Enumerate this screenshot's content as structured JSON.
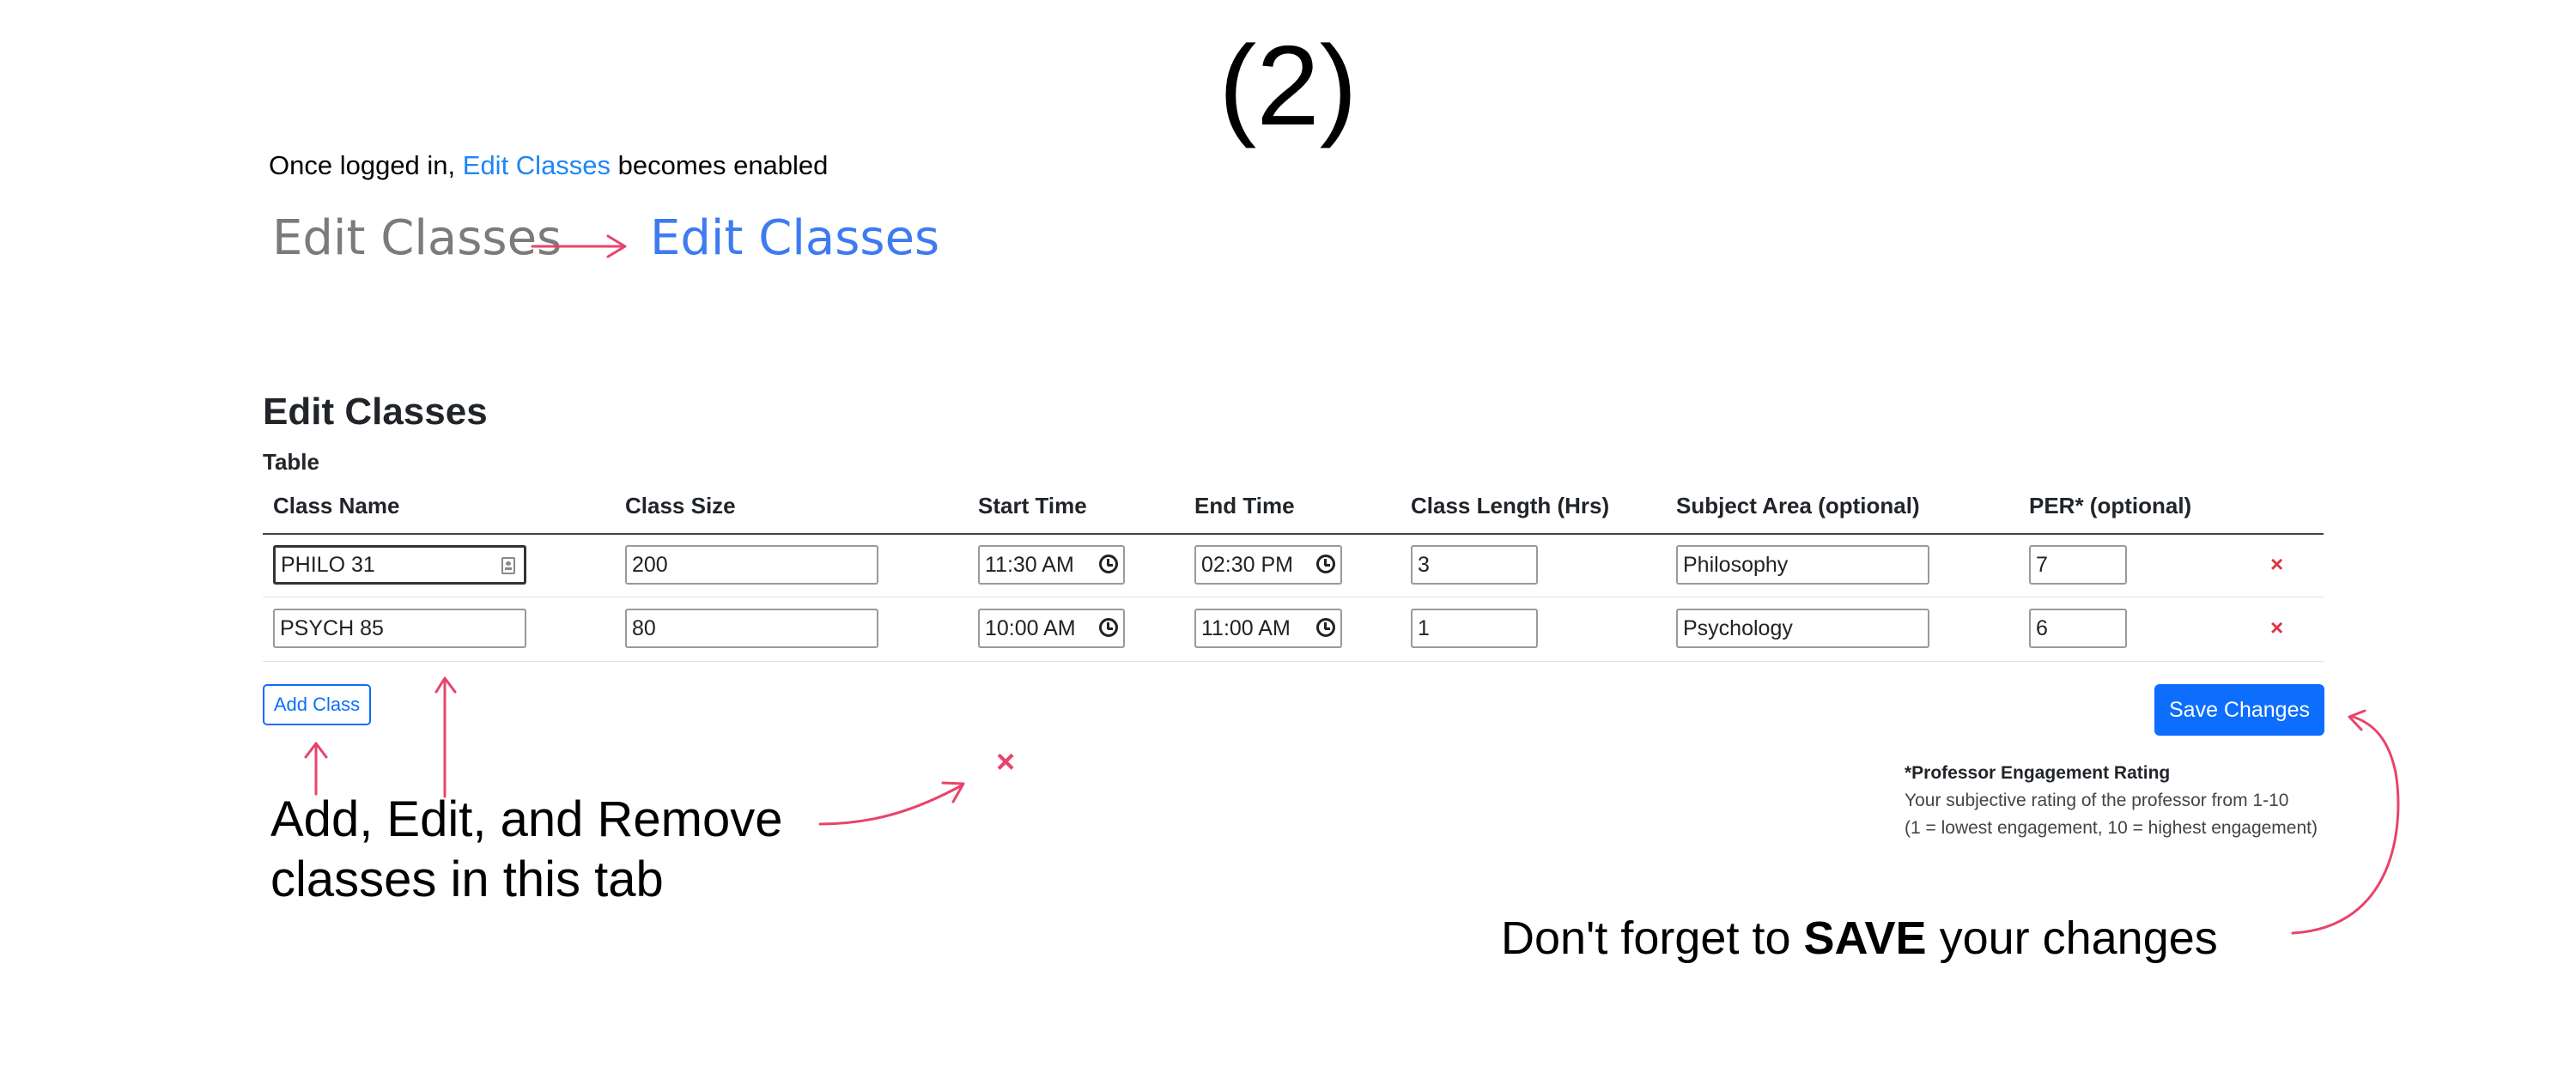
{
  "header": {
    "step": "(2)"
  },
  "intro": {
    "prefix": "Once logged in, ",
    "link": "Edit Classes",
    "suffix": " becomes enabled"
  },
  "nav_demo": {
    "disabled_label": "Edit Classes",
    "enabled_label": "Edit Classes"
  },
  "section": {
    "title": "Edit Classes",
    "table_caption": "Table"
  },
  "table": {
    "headers": [
      "Class Name",
      "Class Size",
      "Start Time",
      "End Time",
      "Class Length (Hrs)",
      "Subject Area (optional)",
      "PER* (optional)"
    ],
    "rows": [
      {
        "class_name": "PHILO 31",
        "class_size": "200",
        "start_time": "11:30 AM",
        "end_time": "02:30 PM",
        "length": "3",
        "subject": "Philosophy",
        "per": "7",
        "remove": "×"
      },
      {
        "class_name": "PSYCH 85",
        "class_size": "80",
        "start_time": "10:00 AM",
        "end_time": "11:00 AM",
        "length": "1",
        "subject": "Psychology",
        "per": "6",
        "remove": "×"
      }
    ]
  },
  "buttons": {
    "add_class": "Add Class",
    "save_changes": "Save Changes"
  },
  "per_note": {
    "title": "*Professor Engagement Rating",
    "line1": "Your subjective rating of the professor from 1-10",
    "line2": "(1 = lowest engagement, 10 = highest engagement)"
  },
  "annotations": {
    "left_line1": "Add, Edit, and Remove",
    "left_line2": "classes in this tab",
    "example_remove": "×",
    "right_prefix": "Don't forget to ",
    "right_bold": "SAVE",
    "right_suffix": " your changes"
  },
  "colors": {
    "accent": "#0d6efd",
    "link": "#1f86f7",
    "annotation_arrow": "#e8436b",
    "remove": "#dc3545",
    "disabled": "#7b7b7b"
  },
  "icons": {
    "time_picker": "clock-icon",
    "autofill": "contact-card-icon"
  }
}
